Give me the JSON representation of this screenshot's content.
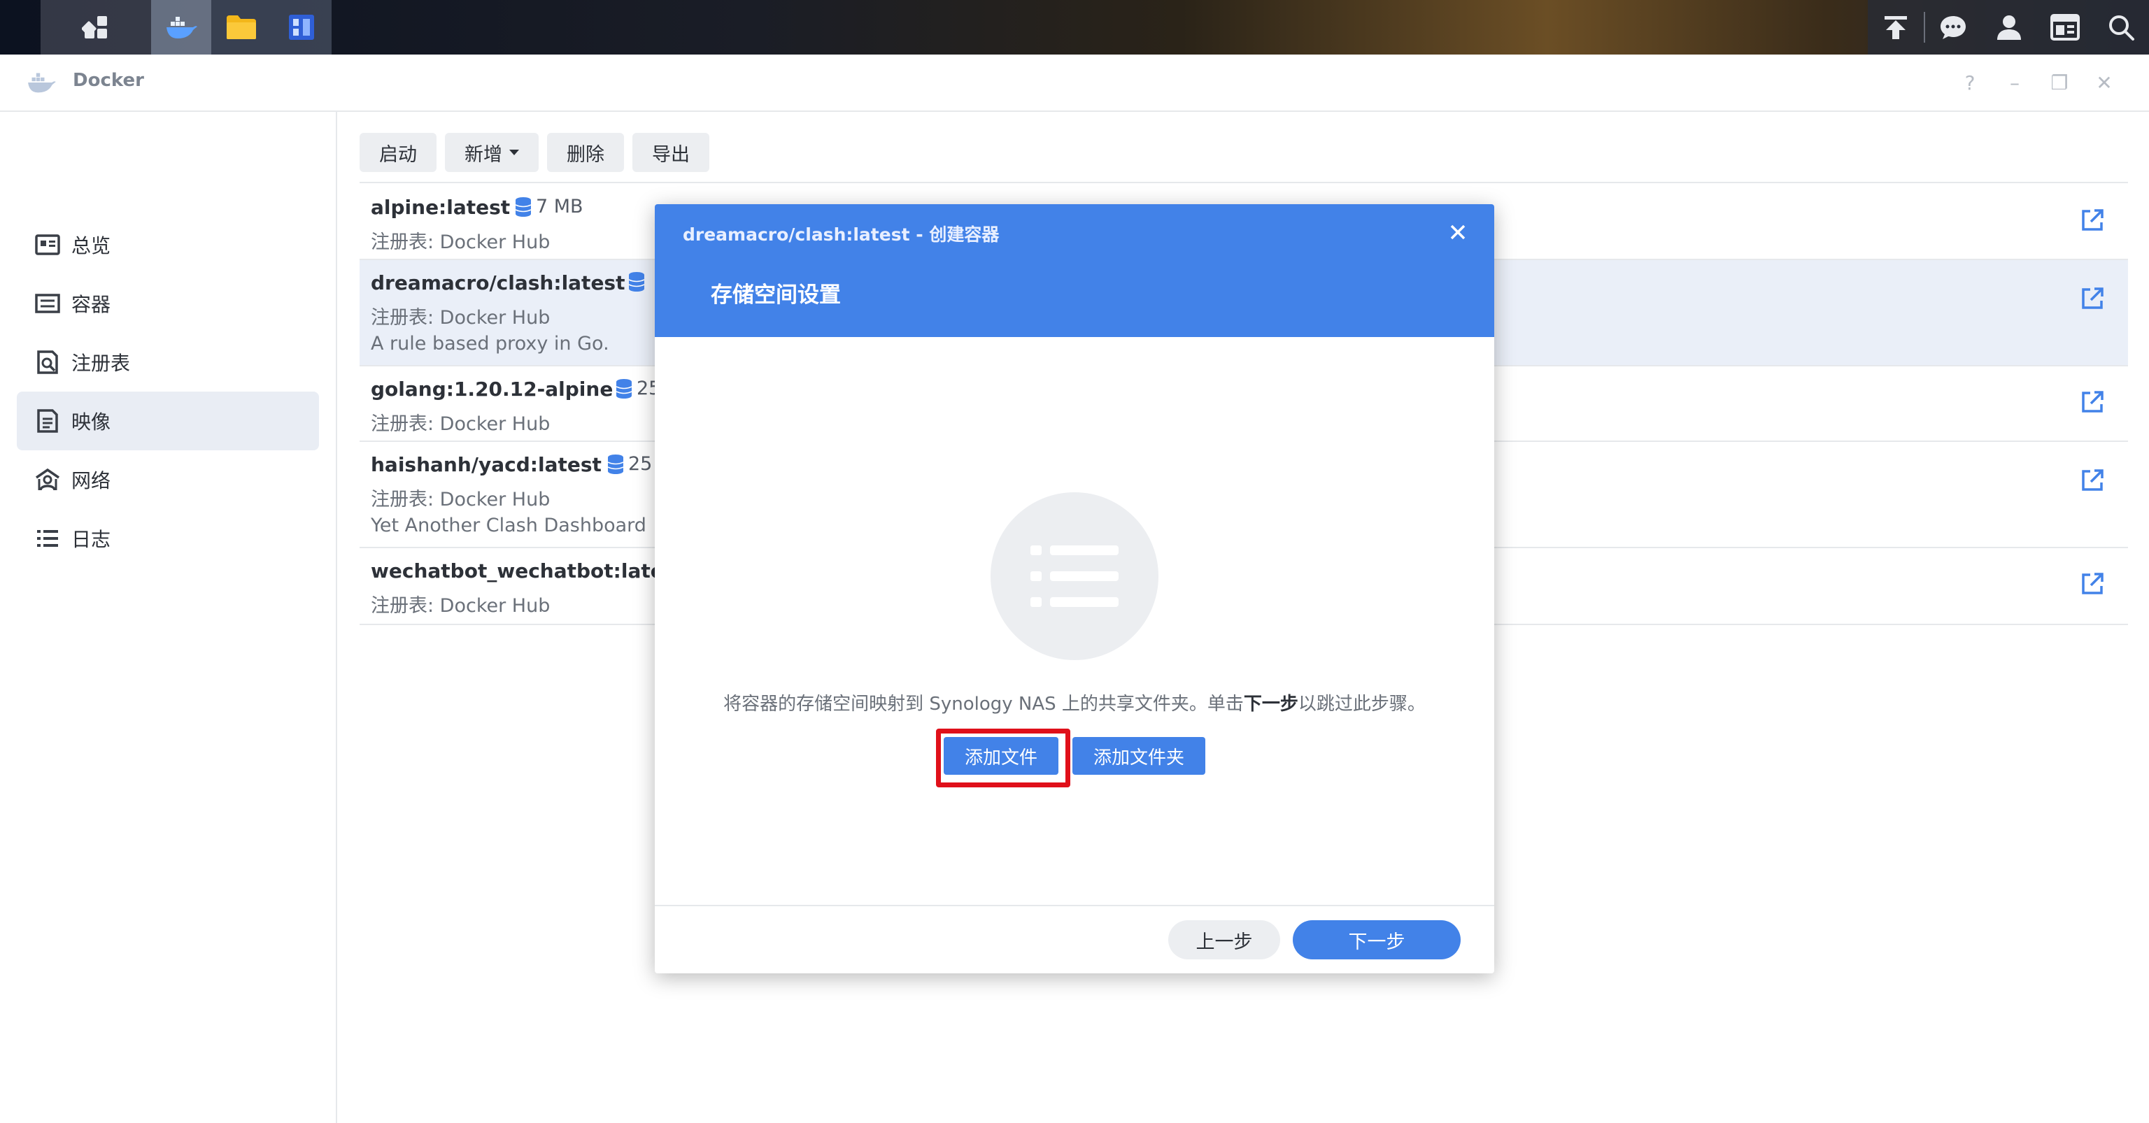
{
  "taskbar": {
    "left_icons": [
      "grid-icon",
      "docker-icon",
      "folder-icon",
      "app-icon"
    ],
    "right_icons": [
      "upload-icon",
      "chat-icon",
      "user-icon",
      "widget-icon",
      "search-icon"
    ]
  },
  "window": {
    "title": "Docker",
    "controls": [
      "?",
      "–",
      "❐",
      "✕"
    ]
  },
  "sidebar": {
    "items": [
      {
        "label": "总览",
        "icon": "overview-icon"
      },
      {
        "label": "容器",
        "icon": "container-icon"
      },
      {
        "label": "注册表",
        "icon": "registry-icon"
      },
      {
        "label": "映像",
        "icon": "image-icon",
        "active": true
      },
      {
        "label": "网络",
        "icon": "network-icon"
      },
      {
        "label": "日志",
        "icon": "log-icon"
      }
    ]
  },
  "toolbar": {
    "start": "启动",
    "add": "新增",
    "delete": "删除",
    "export": "导出"
  },
  "images": [
    {
      "name": "alpine:latest",
      "size": "7 MB",
      "registry": "注册表: Docker Hub",
      "desc": ""
    },
    {
      "name": "dreamacro/clash:latest",
      "size": "",
      "registry": "注册表: Docker Hub",
      "desc": "A rule based proxy in Go."
    },
    {
      "name": "golang:1.20.12-alpine",
      "size": "25",
      "registry": "注册表: Docker Hub",
      "desc": ""
    },
    {
      "name": "haishanh/yacd:latest",
      "size": "25",
      "registry": "注册表: Docker Hub",
      "desc": "Yet Another Clash Dashboard"
    },
    {
      "name": "wechatbot_wechatbot:lates",
      "size": "",
      "registry": "注册表: Docker Hub",
      "desc": ""
    }
  ],
  "dialog": {
    "title": "dreamacro/clash:latest - 创建容器",
    "step": "存储空间设置",
    "desc_before": "将容器的存储空间映射到 Synology NAS 上的共享文件夹。单击",
    "desc_bold": "下一步",
    "desc_after": "以跳过此步骤。",
    "add_file": "添加文件",
    "add_folder": "添加文件夹",
    "prev": "上一步",
    "next": "下一步"
  },
  "colors": {
    "accent": "#4282e8",
    "highlight": "#e0101a",
    "selected_row": "#eaeff8"
  }
}
